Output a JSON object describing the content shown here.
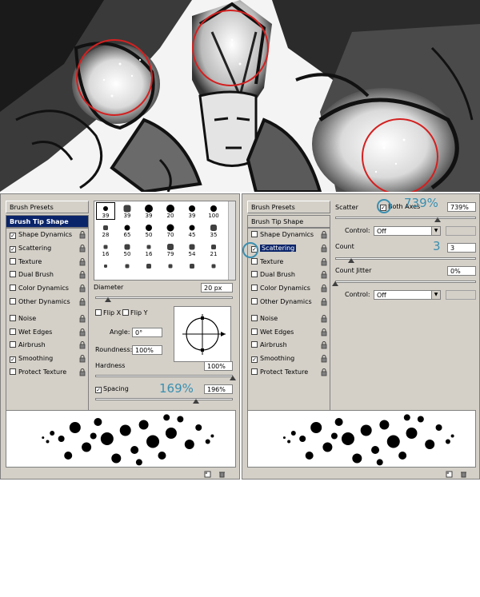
{
  "left_panel": {
    "brush_presets_label": "Brush Presets",
    "brush_tip_shape_label": "Brush Tip Shape",
    "items": [
      {
        "label": "Shape Dynamics",
        "checked": true
      },
      {
        "label": "Scattering",
        "checked": true
      },
      {
        "label": "Texture",
        "checked": false
      },
      {
        "label": "Dual Brush",
        "checked": false
      },
      {
        "label": "Color Dynamics",
        "checked": false
      },
      {
        "label": "Other Dynamics",
        "checked": false
      },
      {
        "label": "Noise",
        "checked": false
      },
      {
        "label": "Wet Edges",
        "checked": false
      },
      {
        "label": "Airbrush",
        "checked": false
      },
      {
        "label": "Smoothing",
        "checked": true
      },
      {
        "label": "Protect Texture",
        "checked": false
      }
    ],
    "brush_sizes": [
      "39",
      "39",
      "39",
      "20",
      "39",
      "100",
      "28",
      "65",
      "50",
      "70",
      "45",
      "35",
      "16",
      "50",
      "16",
      "79",
      "54",
      "21",
      "",
      "",
      "",
      "",
      "",
      ""
    ],
    "diameter_label": "Diameter",
    "diameter_value": "20 px",
    "flip_x_label": "Flip X",
    "flip_y_label": "Flip Y",
    "angle_label": "Angle:",
    "angle_value": "0°",
    "roundness_label": "Roundness:",
    "roundness_value": "100%",
    "hardness_label": "Hardness",
    "hardness_value": "100%",
    "spacing_label": "Spacing",
    "spacing_value": "196%",
    "spacing_annotation": "169%"
  },
  "right_panel": {
    "brush_presets_label": "Brush Presets",
    "brush_tip_shape_label": "Brush Tip Shape",
    "items": [
      {
        "label": "Shape Dynamics",
        "checked": false
      },
      {
        "label": "Scattering",
        "checked": true,
        "selected": true
      },
      {
        "label": "Texture",
        "checked": false
      },
      {
        "label": "Dual Brush",
        "checked": false
      },
      {
        "label": "Color Dynamics",
        "checked": false
      },
      {
        "label": "Other Dynamics",
        "checked": false
      },
      {
        "label": "Noise",
        "checked": false
      },
      {
        "label": "Wet Edges",
        "checked": false
      },
      {
        "label": "Airbrush",
        "checked": false
      },
      {
        "label": "Smoothing",
        "checked": true
      },
      {
        "label": "Protect Texture",
        "checked": false
      }
    ],
    "scatter_label": "Scatter",
    "both_axes_label": "Both Axes",
    "scatter_value": "739%",
    "scatter_annotation": "739%",
    "control_label": "Control:",
    "control_value": "Off",
    "count_label": "Count",
    "count_value": "3",
    "count_annotation": "3",
    "count_jitter_label": "Count Jitter",
    "count_jitter_value": "0%",
    "control2_label": "Control:",
    "control2_value": "Off"
  },
  "colors": {
    "panel_bg": "#d4d0c8",
    "selection": "#0a246a",
    "annotation": "#3a8fb0",
    "highlight_ring": "#d42020"
  }
}
